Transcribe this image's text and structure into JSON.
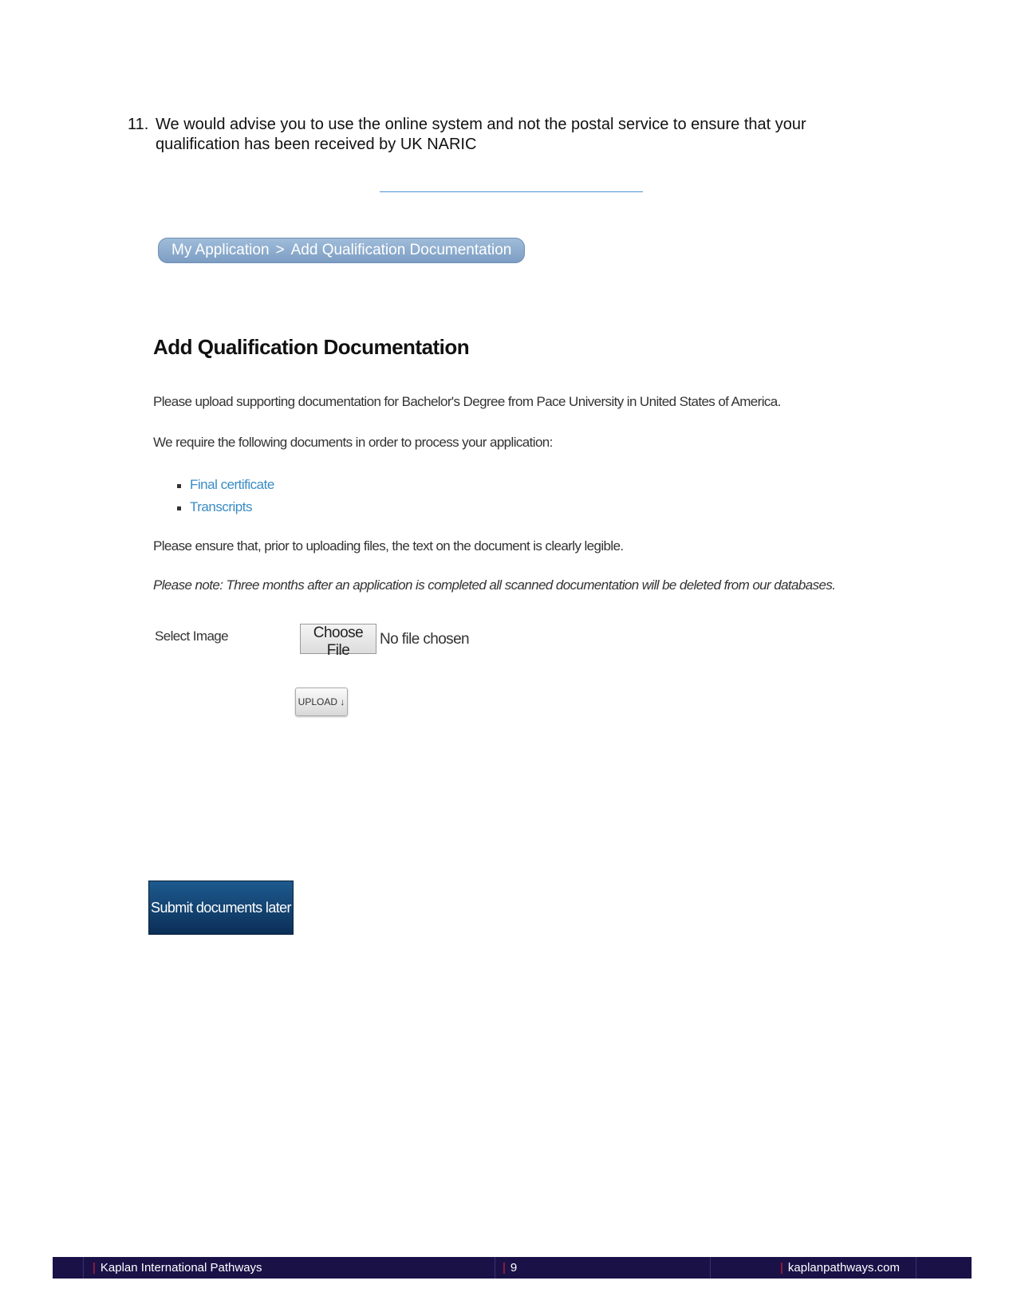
{
  "step": {
    "number": "11.",
    "text": "We would advise you to use the online system and not the postal service to ensure that your qualification has been received by UK NARIC"
  },
  "breadcrumb": {
    "items": [
      "My Application",
      "Add Qualification Documentation"
    ],
    "separator": ">"
  },
  "page": {
    "title": "Add Qualification Documentation",
    "intro": "Please upload supporting documentation for Bachelor's Degree from Pace University in United States of America.",
    "require": "We require the following documents in order to process your application:",
    "documents": [
      "Final certificate",
      "Transcripts"
    ],
    "legible_note": "Please ensure that, prior to uploading files, the text on the document is clearly legible.",
    "deletion_note": "Please note: Three months after an application is completed all scanned documentation will be deleted from our databases."
  },
  "upload_form": {
    "select_label": "Select Image",
    "choose_file_label": "Choose File",
    "file_status": "No file chosen",
    "upload_label": "UPLOAD ↓"
  },
  "actions": {
    "submit_later_label": "Submit documents later"
  },
  "footer": {
    "left": "Kaplan International Pathways",
    "center": "9",
    "right": "kaplanpathways.com"
  },
  "colors": {
    "link": "#3a8cc6",
    "footer_bg": "#1a1247",
    "footer_accent": "#d0203a",
    "button_dark_blue": "#0b2f57"
  }
}
